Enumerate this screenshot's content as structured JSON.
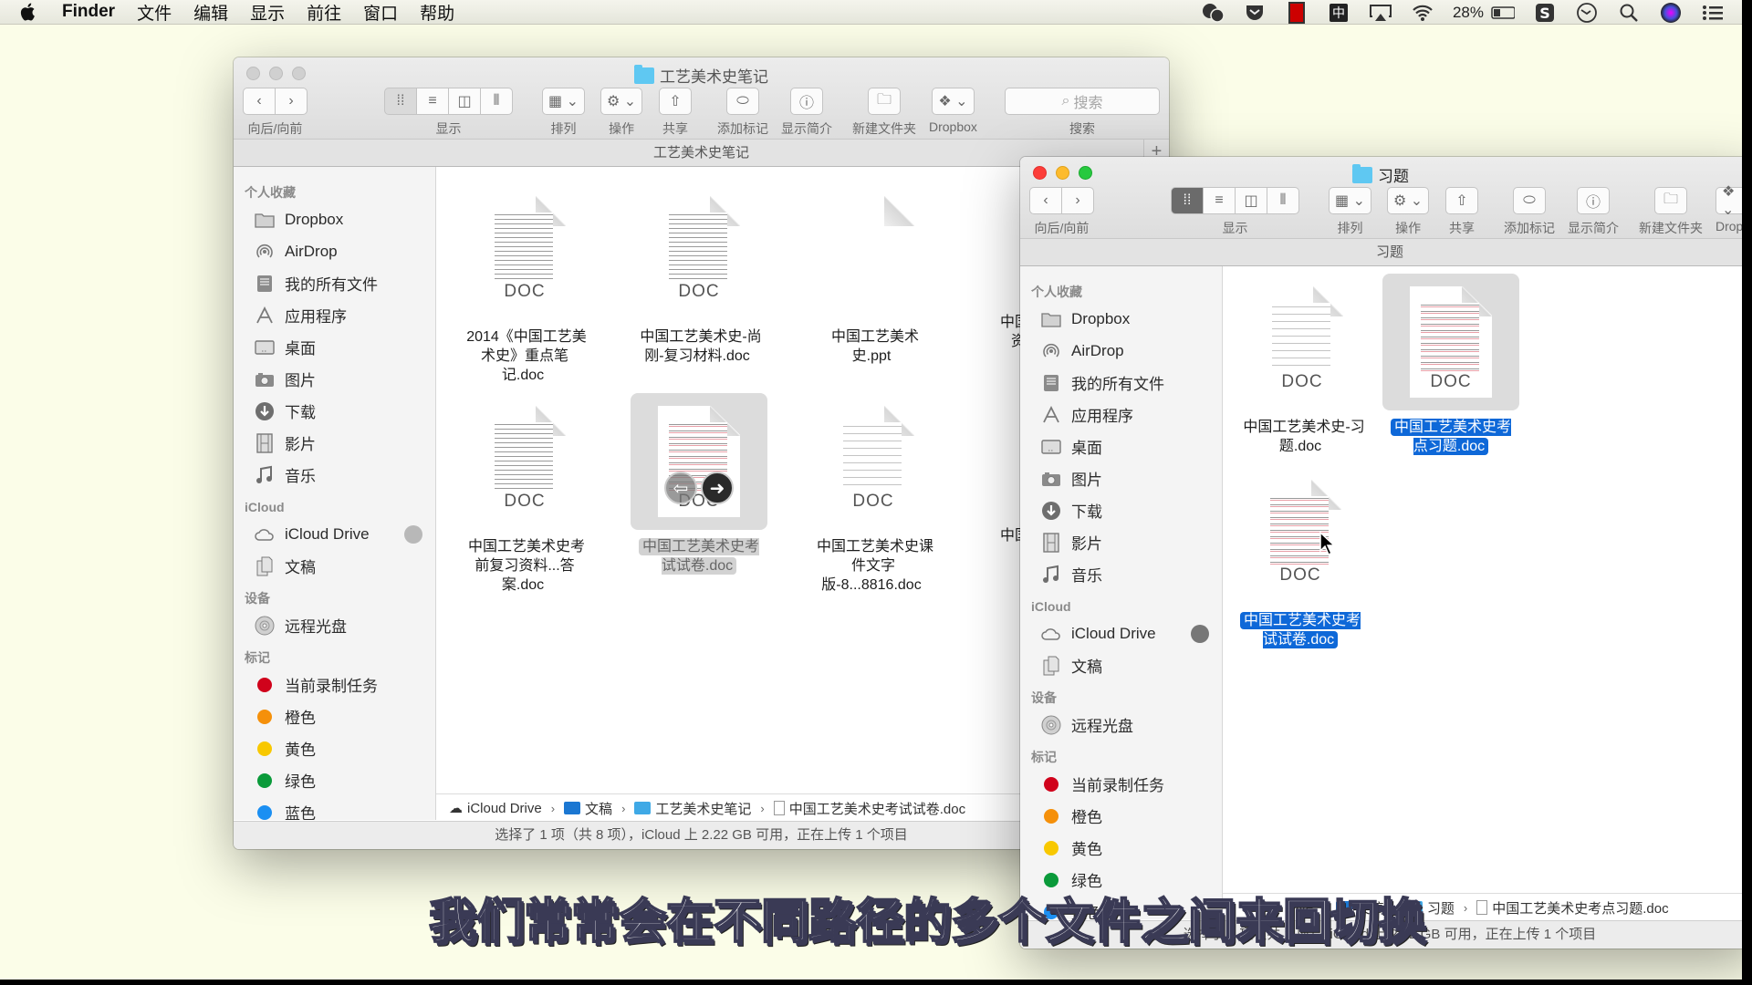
{
  "menubar": {
    "app_name": "Finder",
    "items": [
      "文件",
      "编辑",
      "显示",
      "前往",
      "窗口",
      "帮助"
    ],
    "status_icons": [
      "wechat-icon",
      "pocket-icon",
      "video-record-icon",
      "input-method-icon",
      "airplay-icon",
      "wifi-icon"
    ],
    "battery_percent": "28%",
    "status_icons_right": [
      "sogou-icon",
      "time-machine-icon",
      "spotlight-icon",
      "siri-icon",
      "notification-center-icon"
    ],
    "input_method_label": "中"
  },
  "toolbar_labels": {
    "back_forward": "向后/向前",
    "view": "显示",
    "arrange": "排列",
    "action": "操作",
    "share": "共享",
    "add_tag": "添加标记",
    "get_info": "显示简介",
    "new_folder": "新建文件夹",
    "dropbox": "Dropbox",
    "search": "搜索",
    "search_placeholder": "搜索"
  },
  "sidebar": {
    "favorites_header": "个人收藏",
    "favorites": [
      {
        "label": "Dropbox",
        "icon": "folder-icon"
      },
      {
        "label": "AirDrop",
        "icon": "airdrop-icon"
      },
      {
        "label": "我的所有文件",
        "icon": "all-files-icon"
      },
      {
        "label": "应用程序",
        "icon": "applications-icon"
      },
      {
        "label": "桌面",
        "icon": "desktop-icon"
      },
      {
        "label": "图片",
        "icon": "camera-icon"
      },
      {
        "label": "下载",
        "icon": "download-icon"
      },
      {
        "label": "影片",
        "icon": "film-icon"
      },
      {
        "label": "音乐",
        "icon": "music-note-icon"
      }
    ],
    "icloud_header": "iCloud",
    "icloud": [
      {
        "label": "iCloud Drive",
        "icon": "cloud-icon"
      },
      {
        "label": "文稿",
        "icon": "documents-icon"
      }
    ],
    "devices_header": "设备",
    "devices": [
      {
        "label": "远程光盘",
        "icon": "disc-icon"
      }
    ],
    "tags_header": "标记",
    "tags": [
      {
        "label": "当前录制任务",
        "color": "#d0021b"
      },
      {
        "label": "橙色",
        "color": "#f5900a"
      },
      {
        "label": "黄色",
        "color": "#f8c800"
      },
      {
        "label": "绿色",
        "color": "#0a9a3a"
      },
      {
        "label": "蓝色",
        "color": "#1b8ff2"
      }
    ]
  },
  "window1": {
    "title": "工艺美术史笔记",
    "path_title": "工艺美术史笔记",
    "files": [
      {
        "name": "2014《中国工艺美术史》重点笔记.doc",
        "type": "DOC",
        "style": "dense",
        "state": ""
      },
      {
        "name": "中国工艺美术史-尚刚-复习材料.doc",
        "type": "DOC",
        "style": "dense",
        "state": ""
      },
      {
        "name": "中国工艺美术史.ppt",
        "type": "",
        "style": "blank",
        "state": ""
      },
      {
        "name": "中国工艺美术史考前复习资料...答案.doc",
        "type": "DOC",
        "style": "dense",
        "state": ""
      },
      {
        "name": "中国工艺美术史考试试卷.doc",
        "type": "DOC",
        "style": "red",
        "state": "selected"
      },
      {
        "name": "中国工艺美术史课件文字版-8...8816.doc",
        "type": "DOC",
        "style": "light",
        "state": ""
      }
    ],
    "partial_files": [
      "中国",
      "资",
      "中国"
    ],
    "breadcrumb": [
      "iCloud Drive",
      "文稿",
      "工艺美术史笔记",
      "中国工艺美术史考试试卷.doc"
    ],
    "status": "选择了 1 项（共 8 项），iCloud 上 2.22 GB 可用，正在上传 1 个项目"
  },
  "window2": {
    "title": "习题",
    "path_title": "习题",
    "toolbar_dropbox_partial": "Dropb",
    "files": [
      {
        "name": "中国工艺美术史-习题.doc",
        "type": "DOC",
        "style": "light",
        "state": ""
      },
      {
        "name": "中国工艺美术史考点习题.doc",
        "type": "DOC",
        "style": "red",
        "state": "selected-active"
      },
      {
        "name": "中国工艺美术史考试试卷.doc",
        "type": "DOC",
        "style": "red",
        "state": "dragging"
      }
    ],
    "breadcrumb": [
      "ive",
      "文稿",
      "习题",
      "中国工艺美术史考点习题.doc"
    ],
    "status": "选择了 1 项（共 2 项），iCloud 上 2.22 GB 可用，正在上传 1 个项目"
  },
  "subtitle": "我们常常会在不同路径的多个文件之间来回切换"
}
